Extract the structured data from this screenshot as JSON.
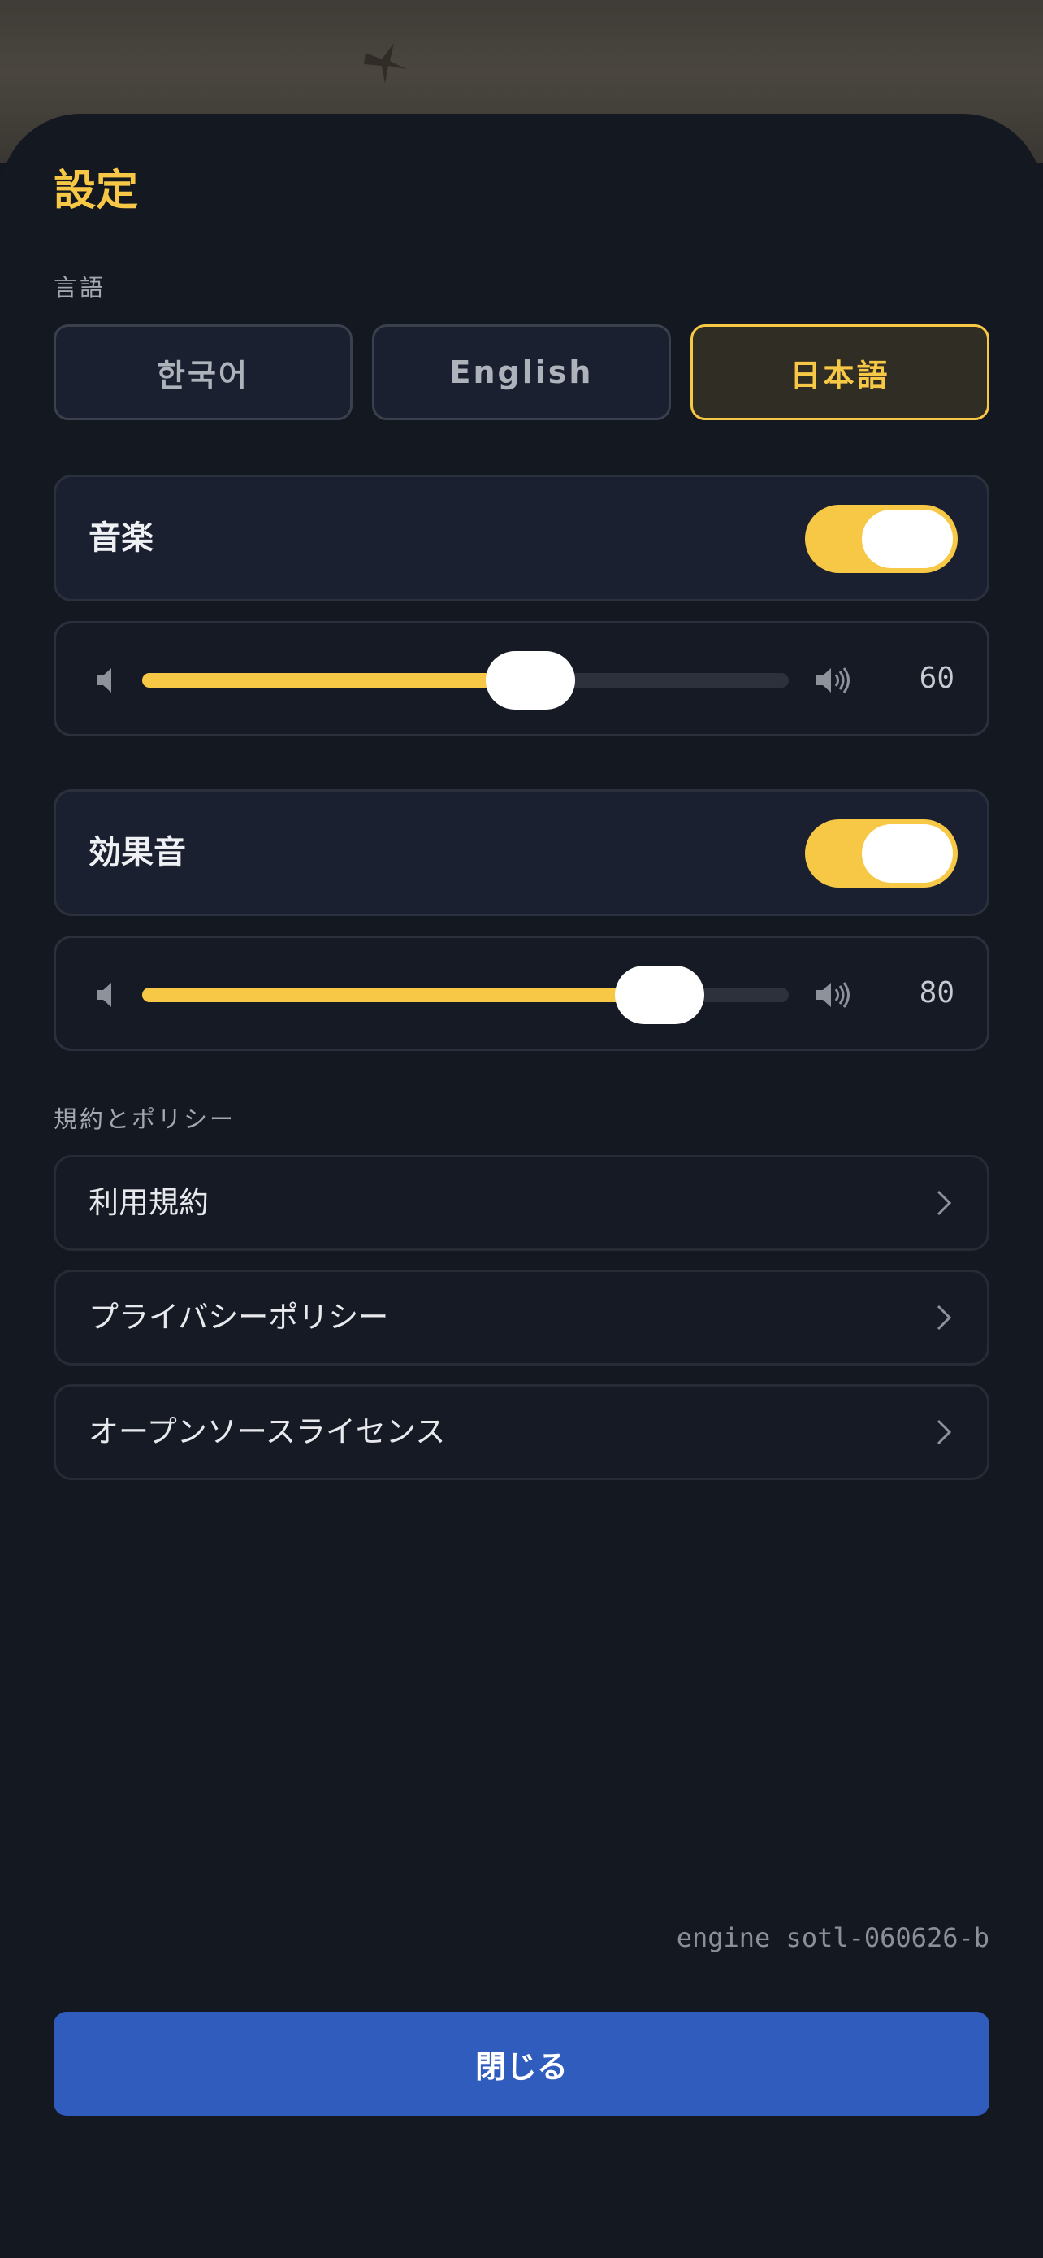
{
  "title": "設定",
  "language": {
    "section_label": "言語",
    "options": [
      "한국어",
      "English",
      "日本語"
    ],
    "selected": "日本語"
  },
  "music": {
    "label": "音楽",
    "enabled": true,
    "volume": 60,
    "volume_text": "60"
  },
  "sfx": {
    "label": "効果音",
    "enabled": true,
    "volume": 80,
    "volume_text": "80"
  },
  "policy": {
    "section_label": "規約とポリシー",
    "items": [
      {
        "label": "利用規約"
      },
      {
        "label": "プライバシーポリシー"
      },
      {
        "label": "オープンソースライセンス"
      }
    ]
  },
  "engine_version": "engine sotl-060626-b",
  "close_label": "閉じる",
  "colors": {
    "accent": "#f7c845",
    "primary_button": "#2f5cbd",
    "background": "#141821"
  },
  "icons": {
    "volume_low": "speaker-low-icon",
    "volume_high": "speaker-high-icon",
    "chevron": "chevron-right-icon"
  }
}
